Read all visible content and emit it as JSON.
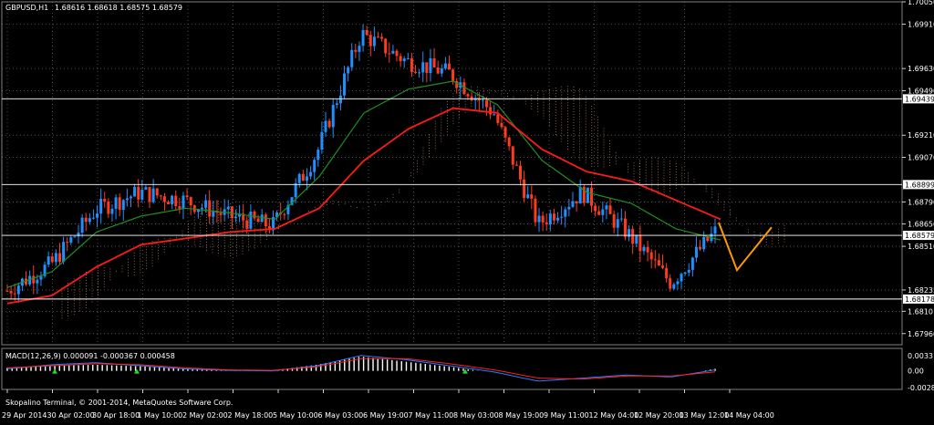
{
  "window": {
    "title": "GBPUSD,H1",
    "quote_values": "1.68616 1.68618 1.68575 1.68579"
  },
  "macd_panel": {
    "title": "MACD(12,26,9) 0.000091 -0.000367 0.000458",
    "scale_labels": [
      "0.003315",
      "0.00",
      "-0.002899"
    ]
  },
  "copyright": "Skopalino Terminal, © 2001-2014, MetaQuotes Software Corp.",
  "price_axis": {
    "ticks": [
      "1.70050",
      "1.69910",
      "1.69630",
      "1.69490",
      "1.69210",
      "1.69070",
      "1.68790",
      "1.68650",
      "1.68510",
      "1.68235",
      "1.68101",
      "1.67960"
    ],
    "level_labels": [
      "1.69439",
      "1.68899",
      "1.68579",
      "1.68178"
    ]
  },
  "time_axis": [
    "29 Apr 2014",
    "30 Apr 02:00",
    "30 Apr 18:00",
    "1 May 10:00",
    "2 May 02:00",
    "2 May 18:00",
    "5 May 10:00",
    "6 May 03:00",
    "6 May 19:00",
    "7 May 11:00",
    "8 May 03:00",
    "8 May 19:00",
    "9 May 11:00",
    "12 May 04:00",
    "12 May 20:00",
    "13 May 12:00",
    "14 May 04:00"
  ],
  "colors": {
    "background": "#000000",
    "grid": "#7f7f7f",
    "bull_candle": "#1e90ff",
    "bear_candle": "#ff3b1e",
    "ma_slow": "#ff1a1a",
    "ma_fast": "#1f8f1f",
    "cloud": "#f5b08a",
    "forecast": "#ff9900",
    "macd_hist": "#ffffff",
    "macd_line": "#2b7bff",
    "signal_line": "#ff2020"
  },
  "chart_data": {
    "type": "line",
    "title": "GBPUSD,H1",
    "ylim": [
      1.6789,
      1.7005
    ],
    "categories": [
      "29 Apr 2014",
      "30 Apr 02:00",
      "30 Apr 18:00",
      "1 May 10:00",
      "2 May 02:00",
      "2 May 18:00",
      "5 May 10:00",
      "6 May 03:00",
      "6 May 19:00",
      "7 May 11:00",
      "8 May 03:00",
      "8 May 19:00",
      "9 May 11:00",
      "12 May 04:00",
      "12 May 20:00",
      "13 May 12:00",
      "14 May 04:00"
    ],
    "series": [
      {
        "values": [
          1.6823,
          1.684,
          1.6874,
          1.6885,
          1.688,
          1.687,
          1.6864,
          1.691,
          1.6985,
          1.6968,
          1.696,
          1.6935,
          1.6865,
          1.6885,
          1.686,
          1.6828,
          1.686
        ]
      },
      {
        "values": [
          1.6815,
          1.682,
          1.6838,
          1.6852,
          1.6856,
          1.686,
          1.6862,
          1.6875,
          1.6905,
          1.6925,
          1.6938,
          1.6935,
          1.6912,
          1.6898,
          1.6892,
          1.688,
          1.6868
        ]
      },
      {
        "values": [
          1.6825,
          1.6835,
          1.686,
          1.687,
          1.6875,
          1.6872,
          1.6868,
          1.6895,
          1.6935,
          1.695,
          1.6955,
          1.694,
          1.6905,
          1.6885,
          1.6878,
          1.6862,
          1.6855
        ]
      }
    ],
    "horizontal_levels": [
      1.69439,
      1.68899,
      1.68579,
      1.68178
    ],
    "forecast": {
      "values": [
        1.6866,
        1.6836,
        1.6863
      ]
    },
    "macd": {
      "ylim": [
        -0.002899,
        0.003315
      ],
      "histogram": [
        0.0006,
        0.001,
        0.0012,
        0.0009,
        0.0004,
        0.0002,
        0.0001,
        0.0012,
        0.0028,
        0.0018,
        0.0008,
        -0.0004,
        -0.0016,
        -0.0012,
        -0.0008,
        -0.001,
        0.0004
      ],
      "macd_line": [
        0.0004,
        0.0012,
        0.0016,
        0.001,
        0.0004,
        0.0001,
        0.0,
        0.001,
        0.003,
        0.0022,
        0.001,
        -0.0002,
        -0.002,
        -0.0014,
        -0.0008,
        -0.0012,
        0.0002
      ],
      "signal_line": [
        0.0006,
        0.001,
        0.0014,
        0.0012,
        0.0006,
        0.0002,
        0.0001,
        0.0008,
        0.0024,
        0.0024,
        0.0014,
        0.0002,
        -0.0014,
        -0.0016,
        -0.001,
        -0.001,
        -0.0002
      ]
    }
  }
}
